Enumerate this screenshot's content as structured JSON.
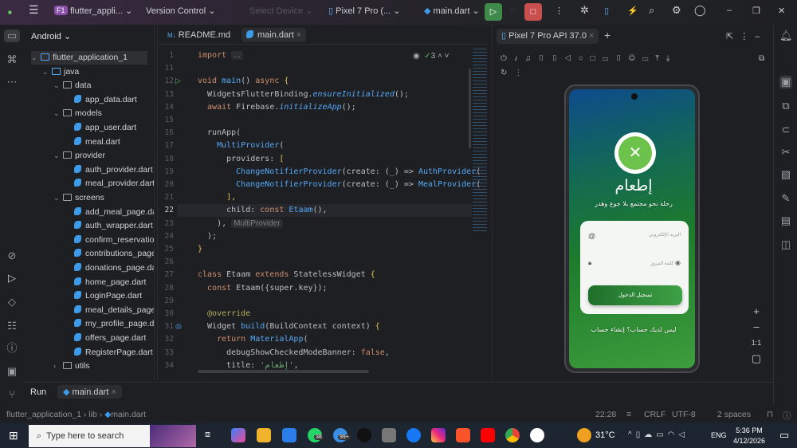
{
  "topbar": {
    "project_badge": "F1",
    "project": "flutter_appli...",
    "vcs": "Version Control",
    "device_select": "Select Device",
    "device": "Pixel 7 Pro (...",
    "run_config": "main.dart"
  },
  "project_panel": {
    "title": "Android",
    "tree": [
      {
        "label": "flutter_application_1",
        "type": "root",
        "level": 0,
        "open": true
      },
      {
        "label": "java",
        "type": "folder",
        "level": 1,
        "open": true
      },
      {
        "label": "data",
        "type": "package",
        "level": 2,
        "open": true
      },
      {
        "label": "app_data.dart",
        "type": "dart",
        "level": 3
      },
      {
        "label": "models",
        "type": "package",
        "level": 2,
        "open": true
      },
      {
        "label": "app_user.dart",
        "type": "dart",
        "level": 3
      },
      {
        "label": "meal.dart",
        "type": "dart",
        "level": 3
      },
      {
        "label": "provider",
        "type": "package",
        "level": 2,
        "open": true
      },
      {
        "label": "auth_provider.dart",
        "type": "dart",
        "level": 3
      },
      {
        "label": "meal_provider.dart",
        "type": "dart",
        "level": 3
      },
      {
        "label": "screens",
        "type": "package",
        "level": 2,
        "open": true
      },
      {
        "label": "add_meal_page.dart",
        "type": "dart",
        "level": 3
      },
      {
        "label": "auth_wrapper.dart",
        "type": "dart",
        "level": 3
      },
      {
        "label": "confirm_reservation",
        "type": "dart",
        "level": 3
      },
      {
        "label": "contributions_page",
        "type": "dart",
        "level": 3
      },
      {
        "label": "donations_page.da",
        "type": "dart",
        "level": 3
      },
      {
        "label": "home_page.dart",
        "type": "dart",
        "level": 3
      },
      {
        "label": "LoginPage.dart",
        "type": "dart",
        "level": 3
      },
      {
        "label": "meal_details_page.",
        "type": "dart",
        "level": 3
      },
      {
        "label": "my_profile_page.da",
        "type": "dart",
        "level": 3
      },
      {
        "label": "offers_page.dart",
        "type": "dart",
        "level": 3
      },
      {
        "label": "RegisterPage.dart",
        "type": "dart",
        "level": 3
      },
      {
        "label": "utils",
        "type": "package",
        "level": 2,
        "open": false
      }
    ]
  },
  "editor": {
    "tabs": [
      {
        "label": "README.md",
        "badge": "M↓"
      },
      {
        "label": "main.dart"
      }
    ],
    "problems": "3",
    "lines": [
      {
        "n": "1",
        "t": [
          [
            "import ",
            "kw"
          ],
          [
            "...",
            "hint"
          ]
        ]
      },
      {
        "n": "11",
        "t": []
      },
      {
        "n": "12",
        "t": [
          [
            "void ",
            "kw"
          ],
          [
            "main",
            "fn"
          ],
          [
            "() ",
            "pl"
          ],
          [
            "async ",
            "kw"
          ],
          [
            "{",
            "br"
          ]
        ]
      },
      {
        "n": "13",
        "t": [
          [
            "  WidgetsFlutterBinding.",
            "pl"
          ],
          [
            "ensureInitialized",
            "it"
          ],
          [
            "();",
            "pl"
          ]
        ]
      },
      {
        "n": "14",
        "t": [
          [
            "  await ",
            "kw"
          ],
          [
            "Firebase.",
            "pl"
          ],
          [
            "initializeApp",
            "it"
          ],
          [
            "();",
            "pl"
          ]
        ]
      },
      {
        "n": "15",
        "t": []
      },
      {
        "n": "16",
        "t": [
          [
            "  runApp(",
            "pl"
          ]
        ]
      },
      {
        "n": "17",
        "t": [
          [
            "    MultiProvider",
            "cls"
          ],
          [
            "(",
            "pl"
          ]
        ]
      },
      {
        "n": "18",
        "t": [
          [
            "      providers: ",
            "pl"
          ],
          [
            "[",
            "br"
          ]
        ]
      },
      {
        "n": "19",
        "t": [
          [
            "        ChangeNotifierProvider",
            "cls"
          ],
          [
            "(create: (_) => ",
            "pl"
          ],
          [
            "AuthProvider",
            "cls"
          ],
          [
            "(",
            "pl"
          ]
        ]
      },
      {
        "n": "20",
        "t": [
          [
            "        ChangeNotifierProvider",
            "cls"
          ],
          [
            "(create: (_) => ",
            "pl"
          ],
          [
            "MealProvider",
            "cls"
          ],
          [
            "(",
            "pl"
          ]
        ]
      },
      {
        "n": "21",
        "t": [
          [
            "      ],",
            "br"
          ]
        ]
      },
      {
        "n": "22",
        "t": [
          [
            "      child: ",
            "pl"
          ],
          [
            "const ",
            "kw"
          ],
          [
            "Etaam",
            "cls"
          ],
          [
            "(),",
            "pl"
          ]
        ]
      },
      {
        "n": "23",
        "t": [
          [
            "    ), ",
            "pl"
          ],
          [
            "MultiProvider",
            "hint"
          ]
        ]
      },
      {
        "n": "24",
        "t": [
          [
            "  );",
            "pl"
          ]
        ]
      },
      {
        "n": "25",
        "t": [
          [
            "}",
            "br"
          ]
        ]
      },
      {
        "n": "26",
        "t": []
      },
      {
        "n": "27",
        "t": [
          [
            "class ",
            "kw"
          ],
          [
            "Etaam ",
            "pl"
          ],
          [
            "extends ",
            "kw"
          ],
          [
            "StatelessWidget ",
            "pl"
          ],
          [
            "{",
            "br"
          ]
        ]
      },
      {
        "n": "28",
        "t": [
          [
            "  const ",
            "kw"
          ],
          [
            "Etaam({super.key});",
            "pl"
          ]
        ]
      },
      {
        "n": "29",
        "t": []
      },
      {
        "n": "30",
        "t": [
          [
            "  @override",
            "ann"
          ]
        ]
      },
      {
        "n": "31",
        "t": [
          [
            "  Widget ",
            "pl"
          ],
          [
            "build",
            "fn"
          ],
          [
            "(BuildContext context) ",
            "pl"
          ],
          [
            "{",
            "br"
          ]
        ]
      },
      {
        "n": "32",
        "t": [
          [
            "    return ",
            "kw"
          ],
          [
            "MaterialApp",
            "cls"
          ],
          [
            "(",
            "pl"
          ]
        ]
      },
      {
        "n": "33",
        "t": [
          [
            "      debugShowCheckedModeBanner: ",
            "pl"
          ],
          [
            "false",
            "kw"
          ],
          [
            ",",
            "pl"
          ]
        ]
      },
      {
        "n": "34",
        "t": [
          [
            "      title: ",
            "pl"
          ],
          [
            "'إطعام'",
            "str"
          ],
          [
            ",",
            "pl"
          ]
        ]
      }
    ]
  },
  "emulator": {
    "tab": "Pixel 7 Pro API 37.0",
    "zoom_ratio": "1:1",
    "app": {
      "title": "إطعام",
      "subtitle": "رحلة نحو مجتمع بلا جوع وهدر",
      "email_hint": "البريد الإلكتروني",
      "password_hint": "كلمة المرور",
      "login_button": "تسجيل الدخول",
      "signup_link": "ليس لديك حساب؟ إنشاء حساب"
    }
  },
  "runbar": {
    "label": "Run",
    "tab": "main.dart"
  },
  "status": {
    "breadcrumb": [
      "flutter_application_1",
      "lib",
      "main.dart"
    ],
    "position": "22:28",
    "line_sep": "CRLF",
    "encoding": "UTF-8",
    "indent": "2 spaces"
  },
  "taskbar": {
    "search_placeholder": "Type here to search",
    "whatsapp_badge": "38",
    "badge_99": "99+",
    "weather": "31°C",
    "lang": "ENG",
    "time": "5:36 PM",
    "date": "4/12/2026"
  }
}
